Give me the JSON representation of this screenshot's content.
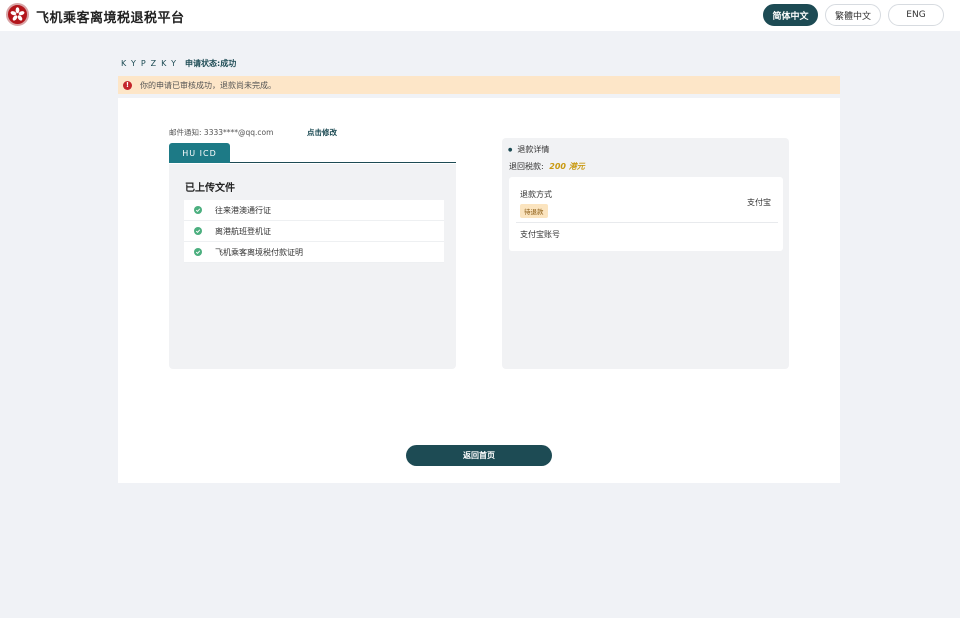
{
  "header": {
    "app_title": "飞机乘客离境税退税平台",
    "languages": [
      "简体中文",
      "繁體中文",
      "ENG"
    ],
    "active_language": "简体中文"
  },
  "breadcrumb": {
    "code": "KYPZKY",
    "status": "申请状态:成功"
  },
  "alert": {
    "icon": "exclamation-icon",
    "message": "你的申请已审核成功，退款尚未完成。",
    "background": "#fde6c8"
  },
  "email": {
    "label": "邮件通知:",
    "value": "3333****@qq.com",
    "edit_label": "点击修改"
  },
  "tab": {
    "label": "HU ICD"
  },
  "documents": {
    "title": "已上传文件",
    "items": [
      "往来港澳通行证",
      "离港航班登机证",
      "飞机乘客离境税付款证明"
    ]
  },
  "refund": {
    "header": "退款详情",
    "amount_label": "退回税款:",
    "amount_value": "200 港元",
    "method_label": "退款方式",
    "method_value": "支付宝",
    "status_badge": "待退款",
    "account_label": "支付宝账号"
  },
  "actions": {
    "back_label": "返回首页"
  },
  "colors": {
    "primary": "#1d4b54",
    "tab": "#1d7a86",
    "accent_amount": "#c99a12",
    "success": "#4caf7f",
    "error": "#c4262b"
  }
}
